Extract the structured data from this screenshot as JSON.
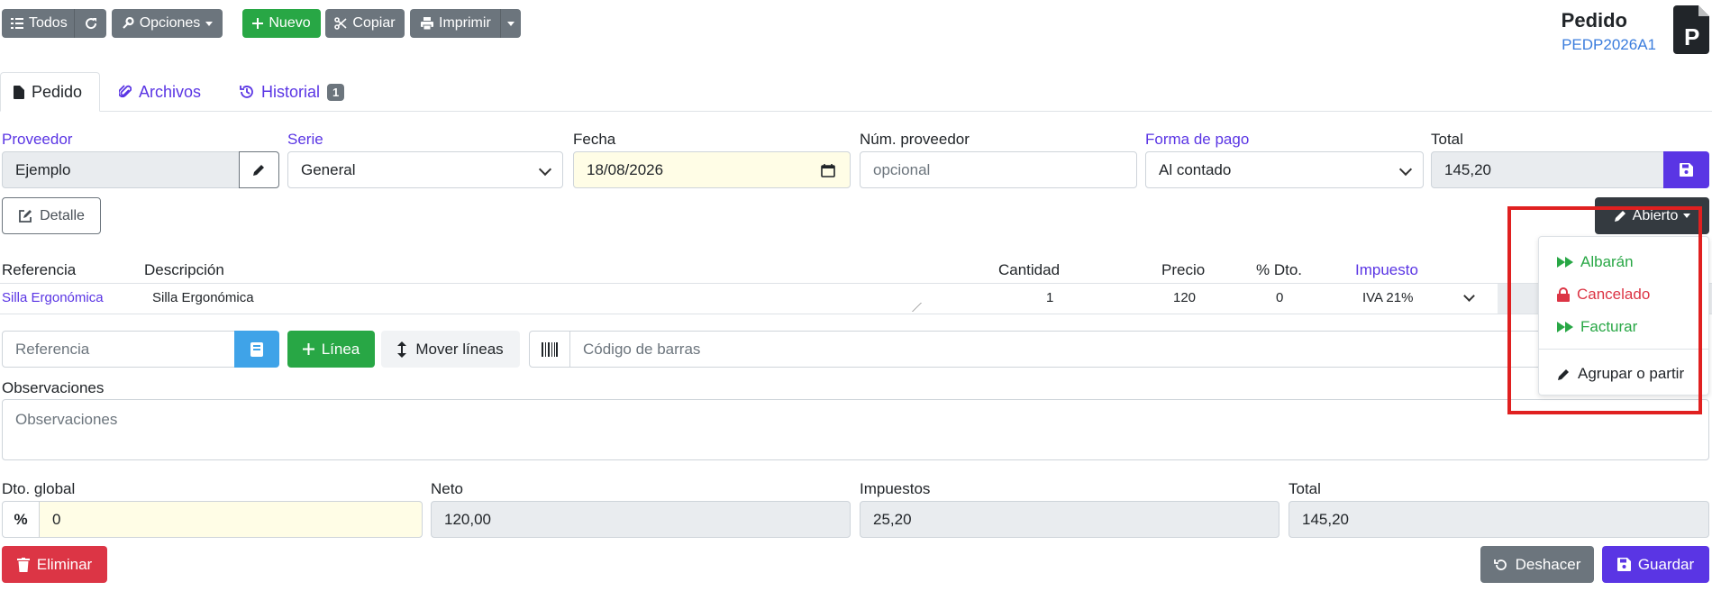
{
  "toolbar": {
    "all_label": "Todos",
    "options_label": "Opciones",
    "new_label": "Nuevo",
    "copy_label": "Copiar",
    "print_label": "Imprimir"
  },
  "doc": {
    "title": "Pedido",
    "code": "PEDP2026A1",
    "icon_letter": "P"
  },
  "tabs": [
    {
      "label": "Pedido"
    },
    {
      "label": "Archivos"
    },
    {
      "label": "Historial",
      "badge": "1"
    }
  ],
  "header_fields": {
    "supplier_label": "Proveedor",
    "supplier_value": "Ejemplo",
    "series_label": "Serie",
    "series_value": "General",
    "date_label": "Fecha",
    "date_value": "18/08/2026",
    "supplier_num_label": "Núm. proveedor",
    "supplier_num_placeholder": "opcional",
    "payment_label": "Forma de pago",
    "payment_value": "Al contado",
    "total_label": "Total",
    "total_value": "145,20"
  },
  "detail_label": "Detalle",
  "status": {
    "label": "Abierto",
    "menu": [
      {
        "label": "Albarán",
        "color": "#28a745"
      },
      {
        "label": "Cancelado",
        "color": "#dc3545"
      },
      {
        "label": "Facturar",
        "color": "#28a745"
      },
      {
        "label": "Agrupar o partir",
        "color": "#212529"
      }
    ]
  },
  "lines": {
    "columns": {
      "reference": "Referencia",
      "description": "Descripción",
      "quantity": "Cantidad",
      "price": "Precio",
      "discount": "% Dto.",
      "tax": "Impuesto"
    },
    "rows": [
      {
        "reference": "Silla Ergonómica",
        "description": "Silla Ergonómica",
        "quantity": "1",
        "price": "120",
        "discount": "0",
        "tax": "IVA 21%"
      }
    ]
  },
  "add_line": {
    "reference_placeholder": "Referencia",
    "line_label": "Línea",
    "move_label": "Mover líneas",
    "barcode_placeholder": "Código de barras"
  },
  "notes": {
    "label": "Observaciones",
    "placeholder": "Observaciones"
  },
  "totals": {
    "global_discount_label": "Dto. global",
    "global_discount_value": "0",
    "net_label": "Neto",
    "net_value": "120,00",
    "taxes_label": "Impuestos",
    "taxes_value": "25,20",
    "total_label": "Total",
    "total_value": "145,20"
  },
  "footer": {
    "delete_label": "Eliminar",
    "undo_label": "Deshacer",
    "save_label": "Guardar"
  },
  "colors": {
    "accent": "#5a35e4",
    "success": "#28a745",
    "danger": "#dc3545",
    "highlight": "#e02020"
  }
}
